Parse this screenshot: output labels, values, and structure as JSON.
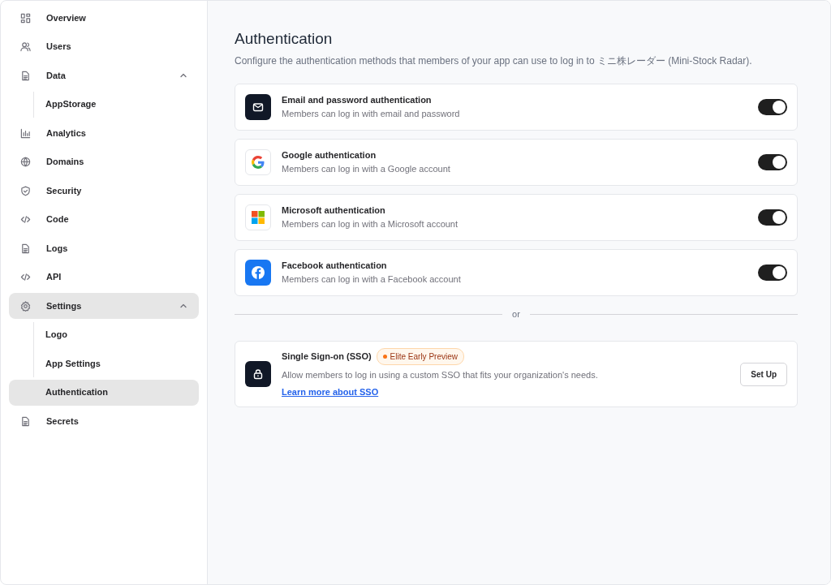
{
  "sidebar": {
    "items": [
      {
        "label": "Overview",
        "selected": false
      },
      {
        "label": "Users",
        "selected": false
      },
      {
        "label": "Data",
        "selected": false,
        "expanded": true,
        "children": [
          {
            "label": "AppStorage",
            "selected": false
          }
        ]
      },
      {
        "label": "Analytics",
        "selected": false
      },
      {
        "label": "Domains",
        "selected": false
      },
      {
        "label": "Security",
        "selected": false
      },
      {
        "label": "Code",
        "selected": false
      },
      {
        "label": "Logs",
        "selected": false
      },
      {
        "label": "API",
        "selected": false
      },
      {
        "label": "Settings",
        "selected": true,
        "expanded": true,
        "children": [
          {
            "label": "Logo",
            "selected": false
          },
          {
            "label": "App Settings",
            "selected": false
          },
          {
            "label": "Authentication",
            "selected": true
          }
        ]
      },
      {
        "label": "Secrets",
        "selected": false
      }
    ]
  },
  "page": {
    "title": "Authentication",
    "description": "Configure the authentication methods that members of your app can use to log in to ミニ株レーダー (Mini-Stock Radar)."
  },
  "methods": [
    {
      "title": "Email and password authentication",
      "description": "Members can log in with email and password",
      "on": true
    },
    {
      "title": "Google authentication",
      "description": "Members can log in with a Google account",
      "on": true
    },
    {
      "title": "Microsoft authentication",
      "description": "Members can log in with a Microsoft account",
      "on": true
    },
    {
      "title": "Facebook authentication",
      "description": "Members can log in with a Facebook account",
      "on": true
    }
  ],
  "divider": "or",
  "sso": {
    "title": "Single Sign-on (SSO)",
    "badge": "Elite Early Preview",
    "description": "Allow members to log in using a custom SSO that fits your organization's needs.",
    "link": "Learn more about SSO",
    "button": "Set Up"
  }
}
